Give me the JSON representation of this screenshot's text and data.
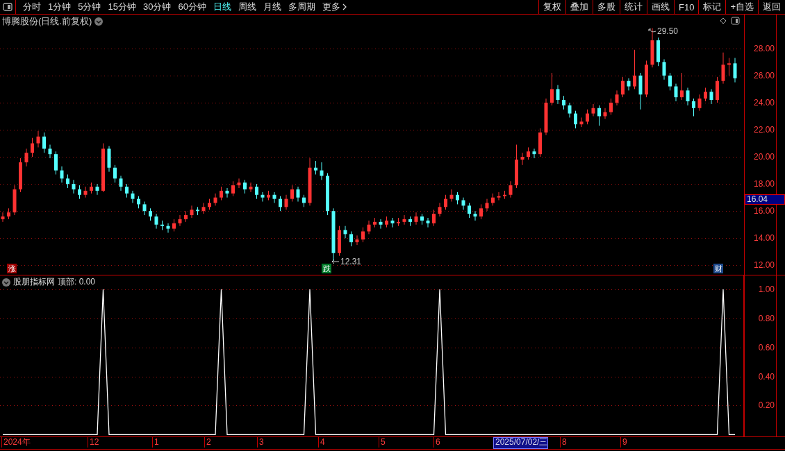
{
  "toolbar": {
    "periods": [
      {
        "label": "分时",
        "selected": false
      },
      {
        "label": "1分钟",
        "selected": false
      },
      {
        "label": "5分钟",
        "selected": false
      },
      {
        "label": "15分钟",
        "selected": false
      },
      {
        "label": "30分钟",
        "selected": false
      },
      {
        "label": "60分钟",
        "selected": false
      },
      {
        "label": "日线",
        "selected": true
      },
      {
        "label": "周线",
        "selected": false
      },
      {
        "label": "月线",
        "selected": false
      },
      {
        "label": "多周期",
        "selected": false
      },
      {
        "label": "更多",
        "selected": false
      }
    ],
    "buttons": [
      "复权",
      "叠加",
      "多股",
      "统计",
      "画线",
      "F10",
      "标记",
      "+自选",
      "返回"
    ]
  },
  "price_chart": {
    "title": "博腾股份(日线.前复权)",
    "current_price": "16.04",
    "high_label": "29.50",
    "low_label": "12.31",
    "markers": [
      {
        "text": "涨",
        "color": "#a00000"
      },
      {
        "text": "跌",
        "color": "#007a2a"
      },
      {
        "text": "财",
        "color": "#1e4a8c"
      }
    ],
    "chart_data": {
      "type": "candlestick",
      "ylim": [
        11.3,
        30.5
      ],
      "grid": true,
      "yticks": [
        {
          "value": 28,
          "label": "28.00"
        },
        {
          "value": 26,
          "label": "26.00"
        },
        {
          "value": 24,
          "label": "24.00"
        },
        {
          "value": 22,
          "label": "22.00"
        },
        {
          "value": 20,
          "label": "20.00"
        },
        {
          "value": 18,
          "label": "18.00"
        },
        {
          "value": 16,
          "label": "16.00"
        },
        {
          "value": 14,
          "label": "14.00"
        },
        {
          "value": 12,
          "label": "12.00"
        }
      ],
      "categories": [
        null,
        null,
        null,
        null,
        null,
        null,
        null,
        null,
        null,
        null,
        null,
        null,
        null,
        null,
        null,
        null,
        null,
        null,
        null,
        null,
        null,
        null,
        null,
        null,
        null,
        null,
        null,
        null,
        null,
        null,
        null,
        null,
        null,
        null,
        null,
        null,
        null,
        null,
        null,
        null,
        null,
        null,
        null,
        null,
        null,
        null,
        null,
        null,
        null,
        null,
        null,
        null,
        null,
        null,
        null,
        null,
        null,
        null,
        null,
        null,
        null,
        null,
        null,
        null,
        null,
        null,
        null,
        null,
        null,
        null,
        null,
        null,
        null,
        null,
        null,
        null,
        null,
        null,
        null,
        null,
        null,
        null,
        null,
        null,
        null,
        null,
        null,
        null,
        null,
        null,
        null,
        null,
        null,
        null,
        null,
        null,
        null,
        null,
        null,
        null,
        null,
        null,
        null,
        null,
        null,
        null,
        null,
        null,
        null,
        null,
        null,
        null,
        null,
        null,
        null,
        null,
        null,
        null,
        null,
        null,
        null,
        null,
        null,
        null,
        null
      ],
      "ohlc": [
        [
          15.4,
          15.9,
          15.2,
          15.6
        ],
        [
          15.6,
          16.2,
          15.4,
          15.9
        ],
        [
          15.9,
          17.9,
          15.7,
          17.6
        ],
        [
          17.6,
          19.9,
          17.4,
          19.6
        ],
        [
          19.6,
          20.6,
          19.3,
          20.3
        ],
        [
          20.3,
          21.4,
          20.0,
          21.0
        ],
        [
          21.0,
          21.9,
          20.7,
          21.5
        ],
        [
          21.5,
          21.8,
          20.3,
          20.6
        ],
        [
          20.6,
          20.9,
          19.9,
          20.2
        ],
        [
          20.2,
          20.4,
          18.7,
          19.0
        ],
        [
          19.0,
          19.3,
          18.1,
          18.4
        ],
        [
          18.4,
          18.7,
          17.7,
          18.0
        ],
        [
          18.0,
          18.3,
          17.3,
          17.6
        ],
        [
          17.6,
          17.9,
          16.9,
          17.2
        ],
        [
          17.2,
          17.8,
          17.0,
          17.5
        ],
        [
          17.5,
          18.1,
          17.3,
          17.8
        ],
        [
          17.8,
          18.0,
          17.2,
          17.5
        ],
        [
          17.5,
          21.0,
          17.4,
          20.6
        ],
        [
          20.6,
          20.8,
          18.9,
          19.2
        ],
        [
          19.2,
          19.4,
          18.1,
          18.4
        ],
        [
          18.4,
          18.6,
          17.5,
          17.8
        ],
        [
          17.8,
          18.0,
          17.0,
          17.3
        ],
        [
          17.3,
          17.5,
          16.6,
          16.9
        ],
        [
          16.9,
          17.1,
          16.2,
          16.5
        ],
        [
          16.5,
          16.7,
          15.7,
          16.0
        ],
        [
          16.0,
          16.2,
          15.3,
          15.6
        ],
        [
          15.6,
          15.8,
          14.7,
          15.0
        ],
        [
          15.0,
          15.3,
          14.6,
          14.9
        ],
        [
          14.9,
          15.1,
          14.4,
          14.7
        ],
        [
          14.7,
          15.4,
          14.5,
          15.1
        ],
        [
          15.1,
          15.7,
          14.9,
          15.4
        ],
        [
          15.4,
          16.0,
          15.2,
          15.7
        ],
        [
          15.7,
          16.4,
          15.5,
          16.1
        ],
        [
          16.1,
          16.3,
          15.7,
          16.0
        ],
        [
          16.0,
          16.6,
          15.8,
          16.3
        ],
        [
          16.3,
          16.9,
          16.1,
          16.6
        ],
        [
          16.6,
          17.3,
          16.4,
          17.0
        ],
        [
          17.0,
          17.8,
          16.8,
          17.5
        ],
        [
          17.5,
          17.7,
          17.0,
          17.3
        ],
        [
          17.3,
          18.2,
          17.1,
          17.9
        ],
        [
          17.9,
          18.4,
          17.7,
          18.1
        ],
        [
          18.1,
          18.3,
          17.3,
          17.6
        ],
        [
          17.6,
          18.1,
          17.4,
          17.8
        ],
        [
          17.8,
          18.0,
          16.9,
          17.2
        ],
        [
          17.2,
          17.4,
          16.7,
          17.0
        ],
        [
          17.0,
          17.5,
          16.8,
          17.2
        ],
        [
          17.2,
          17.4,
          16.6,
          16.9
        ],
        [
          16.9,
          17.1,
          16.0,
          16.3
        ],
        [
          16.3,
          17.2,
          16.1,
          16.9
        ],
        [
          16.9,
          17.9,
          16.7,
          17.6
        ],
        [
          17.6,
          17.8,
          16.7,
          17.0
        ],
        [
          17.0,
          17.2,
          16.3,
          16.6
        ],
        [
          16.6,
          19.9,
          16.4,
          19.2
        ],
        [
          19.2,
          19.7,
          18.7,
          19.0
        ],
        [
          19.0,
          19.6,
          18.3,
          18.6
        ],
        [
          18.6,
          18.8,
          15.7,
          16.0
        ],
        [
          16.0,
          16.2,
          12.31,
          12.9
        ],
        [
          12.9,
          14.9,
          12.7,
          14.6
        ],
        [
          14.6,
          14.9,
          14.0,
          14.3
        ],
        [
          14.3,
          14.5,
          13.4,
          13.7
        ],
        [
          13.7,
          14.2,
          13.5,
          13.9
        ],
        [
          13.9,
          14.8,
          13.7,
          14.5
        ],
        [
          14.5,
          15.3,
          14.3,
          15.0
        ],
        [
          15.0,
          15.5,
          14.8,
          15.2
        ],
        [
          15.2,
          15.4,
          14.7,
          15.0
        ],
        [
          15.0,
          15.6,
          14.8,
          15.3
        ],
        [
          15.3,
          15.5,
          14.8,
          15.1
        ],
        [
          15.1,
          15.5,
          14.9,
          15.2
        ],
        [
          15.2,
          15.7,
          15.0,
          15.4
        ],
        [
          15.4,
          15.6,
          14.9,
          15.2
        ],
        [
          15.2,
          15.9,
          15.0,
          15.6
        ],
        [
          15.6,
          15.8,
          15.0,
          15.3
        ],
        [
          15.3,
          15.5,
          14.8,
          15.1
        ],
        [
          15.1,
          16.1,
          14.9,
          15.8
        ],
        [
          15.8,
          16.6,
          15.6,
          16.3
        ],
        [
          16.3,
          17.2,
          16.1,
          16.9
        ],
        [
          16.9,
          17.6,
          16.7,
          17.2
        ],
        [
          17.2,
          17.4,
          16.5,
          16.8
        ],
        [
          16.8,
          17.0,
          16.1,
          16.4
        ],
        [
          16.4,
          16.6,
          15.5,
          15.8
        ],
        [
          15.8,
          16.0,
          15.3,
          15.6
        ],
        [
          15.6,
          16.5,
          15.4,
          16.2
        ],
        [
          16.2,
          16.9,
          16.0,
          16.6
        ],
        [
          16.6,
          17.3,
          16.4,
          17.0
        ],
        [
          17.0,
          17.4,
          16.8,
          17.1
        ],
        [
          17.1,
          17.5,
          16.9,
          17.2
        ],
        [
          17.2,
          18.2,
          17.0,
          17.9
        ],
        [
          17.9,
          20.9,
          17.7,
          19.8
        ],
        [
          19.8,
          20.3,
          19.4,
          20.0
        ],
        [
          20.0,
          20.7,
          19.8,
          20.4
        ],
        [
          20.4,
          20.6,
          19.9,
          20.2
        ],
        [
          20.2,
          22.1,
          20.0,
          21.8
        ],
        [
          21.8,
          24.3,
          21.6,
          24.0
        ],
        [
          24.0,
          26.2,
          23.8,
          25.0
        ],
        [
          25.0,
          25.3,
          23.9,
          24.2
        ],
        [
          24.2,
          24.5,
          23.5,
          23.8
        ],
        [
          23.8,
          24.0,
          22.9,
          23.2
        ],
        [
          23.2,
          23.4,
          22.1,
          22.4
        ],
        [
          22.4,
          22.9,
          22.2,
          22.6
        ],
        [
          22.6,
          23.5,
          22.4,
          23.2
        ],
        [
          23.2,
          23.9,
          23.0,
          23.6
        ],
        [
          23.6,
          23.8,
          22.3,
          23.0
        ],
        [
          23.0,
          23.6,
          22.8,
          23.3
        ],
        [
          23.3,
          24.3,
          23.1,
          24.0
        ],
        [
          24.0,
          24.9,
          23.8,
          24.6
        ],
        [
          24.6,
          25.9,
          24.4,
          25.6
        ],
        [
          25.6,
          25.8,
          24.9,
          25.2
        ],
        [
          25.2,
          27.9,
          25.0,
          26.0
        ],
        [
          26.0,
          26.2,
          23.5,
          24.6
        ],
        [
          24.6,
          27.1,
          24.4,
          26.8
        ],
        [
          26.8,
          29.5,
          26.6,
          28.6
        ],
        [
          28.6,
          28.8,
          26.7,
          27.0
        ],
        [
          27.0,
          27.2,
          25.7,
          26.0
        ],
        [
          26.0,
          26.2,
          24.9,
          25.2
        ],
        [
          25.2,
          25.4,
          24.1,
          24.4
        ],
        [
          24.4,
          26.2,
          24.2,
          24.9
        ],
        [
          24.9,
          25.1,
          23.8,
          24.1
        ],
        [
          24.1,
          24.3,
          23.0,
          23.6
        ],
        [
          23.6,
          24.6,
          23.4,
          24.3
        ],
        [
          24.3,
          25.1,
          24.1,
          24.8
        ],
        [
          24.8,
          25.0,
          23.9,
          24.2
        ],
        [
          24.2,
          25.9,
          24.0,
          25.6
        ],
        [
          25.6,
          27.7,
          25.4,
          26.8
        ],
        [
          26.8,
          27.3,
          26.0,
          26.9
        ],
        [
          26.9,
          27.3,
          25.5,
          25.8
        ]
      ]
    }
  },
  "indicator": {
    "name": "股朋指标网",
    "readout": "顶部: 0.00",
    "chart_data": {
      "type": "line",
      "ylim": [
        -0.013,
        1
      ],
      "grid": true,
      "categories": [
        null,
        null,
        null,
        null,
        null,
        null,
        null,
        null,
        null,
        null,
        null,
        null,
        null,
        null,
        null,
        null,
        null,
        null,
        null,
        null,
        null,
        null,
        null,
        null,
        null,
        null,
        null,
        null,
        null,
        null,
        null,
        null,
        null,
        null,
        null,
        null,
        null,
        null,
        null,
        null,
        null,
        null,
        null,
        null,
        null,
        null,
        null,
        null,
        null,
        null,
        null,
        null,
        null,
        null,
        null,
        null,
        null,
        null,
        null,
        null,
        null,
        null,
        null,
        null,
        null,
        null,
        null,
        null,
        null,
        null,
        null,
        null,
        null,
        null,
        null,
        null,
        null,
        null,
        null,
        null,
        null,
        null,
        null,
        null,
        null,
        null,
        null,
        null,
        null,
        null,
        null,
        null,
        null,
        null,
        null,
        null,
        null,
        null,
        null,
        null,
        null,
        null,
        null,
        null,
        null,
        null,
        null,
        null,
        null,
        null,
        null,
        null,
        null,
        null,
        null,
        null,
        null,
        null,
        null,
        null,
        null,
        null,
        null,
        null,
        null
      ],
      "series": [
        {
          "color": "#ffffff",
          "values": [
            0,
            0,
            0,
            0,
            0,
            0,
            0,
            0,
            0,
            0,
            0,
            0,
            0,
            0,
            0,
            0,
            0,
            1,
            0,
            0,
            0,
            0,
            0,
            0,
            0,
            0,
            0,
            0,
            0,
            0,
            0,
            0,
            0,
            0,
            0,
            0,
            0,
            1,
            0,
            0,
            0,
            0,
            0,
            0,
            0,
            0,
            0,
            0,
            0,
            0,
            0,
            0,
            1,
            0,
            0,
            0,
            0,
            0,
            0,
            0,
            0,
            0,
            0,
            0,
            0,
            0,
            0,
            0,
            0,
            0,
            0,
            0,
            0,
            0,
            1,
            0,
            0,
            0,
            0,
            0,
            0,
            0,
            0,
            0,
            0,
            0,
            0,
            0,
            0,
            0,
            0,
            0,
            0,
            0,
            0,
            0,
            0,
            0,
            0,
            0,
            0,
            0,
            0,
            0,
            0,
            0,
            0,
            0,
            0,
            0,
            0,
            0,
            0,
            0,
            0,
            0,
            0,
            0,
            0,
            0,
            0,
            0,
            1,
            0,
            0
          ]
        }
      ],
      "yticks": [
        {
          "value": 1,
          "label": "1.00"
        },
        {
          "value": 0.8,
          "label": "0.80"
        },
        {
          "value": 0.6,
          "label": "0.60"
        },
        {
          "value": 0.4,
          "label": "0.40"
        },
        {
          "value": 0.2,
          "label": "0.20"
        }
      ]
    }
  },
  "time_axis": [
    {
      "label": "2024年",
      "selected": false
    },
    {
      "label": "12",
      "selected": false
    },
    {
      "label": "1",
      "selected": false
    },
    {
      "label": "2",
      "selected": false
    },
    {
      "label": "3",
      "selected": false
    },
    {
      "label": "4",
      "selected": false
    },
    {
      "label": "5",
      "selected": false
    },
    {
      "label": "6",
      "selected": false
    },
    {
      "label": "2025/07/02/三",
      "selected": true
    },
    {
      "label": "8",
      "selected": false
    },
    {
      "label": "9",
      "selected": false
    }
  ]
}
